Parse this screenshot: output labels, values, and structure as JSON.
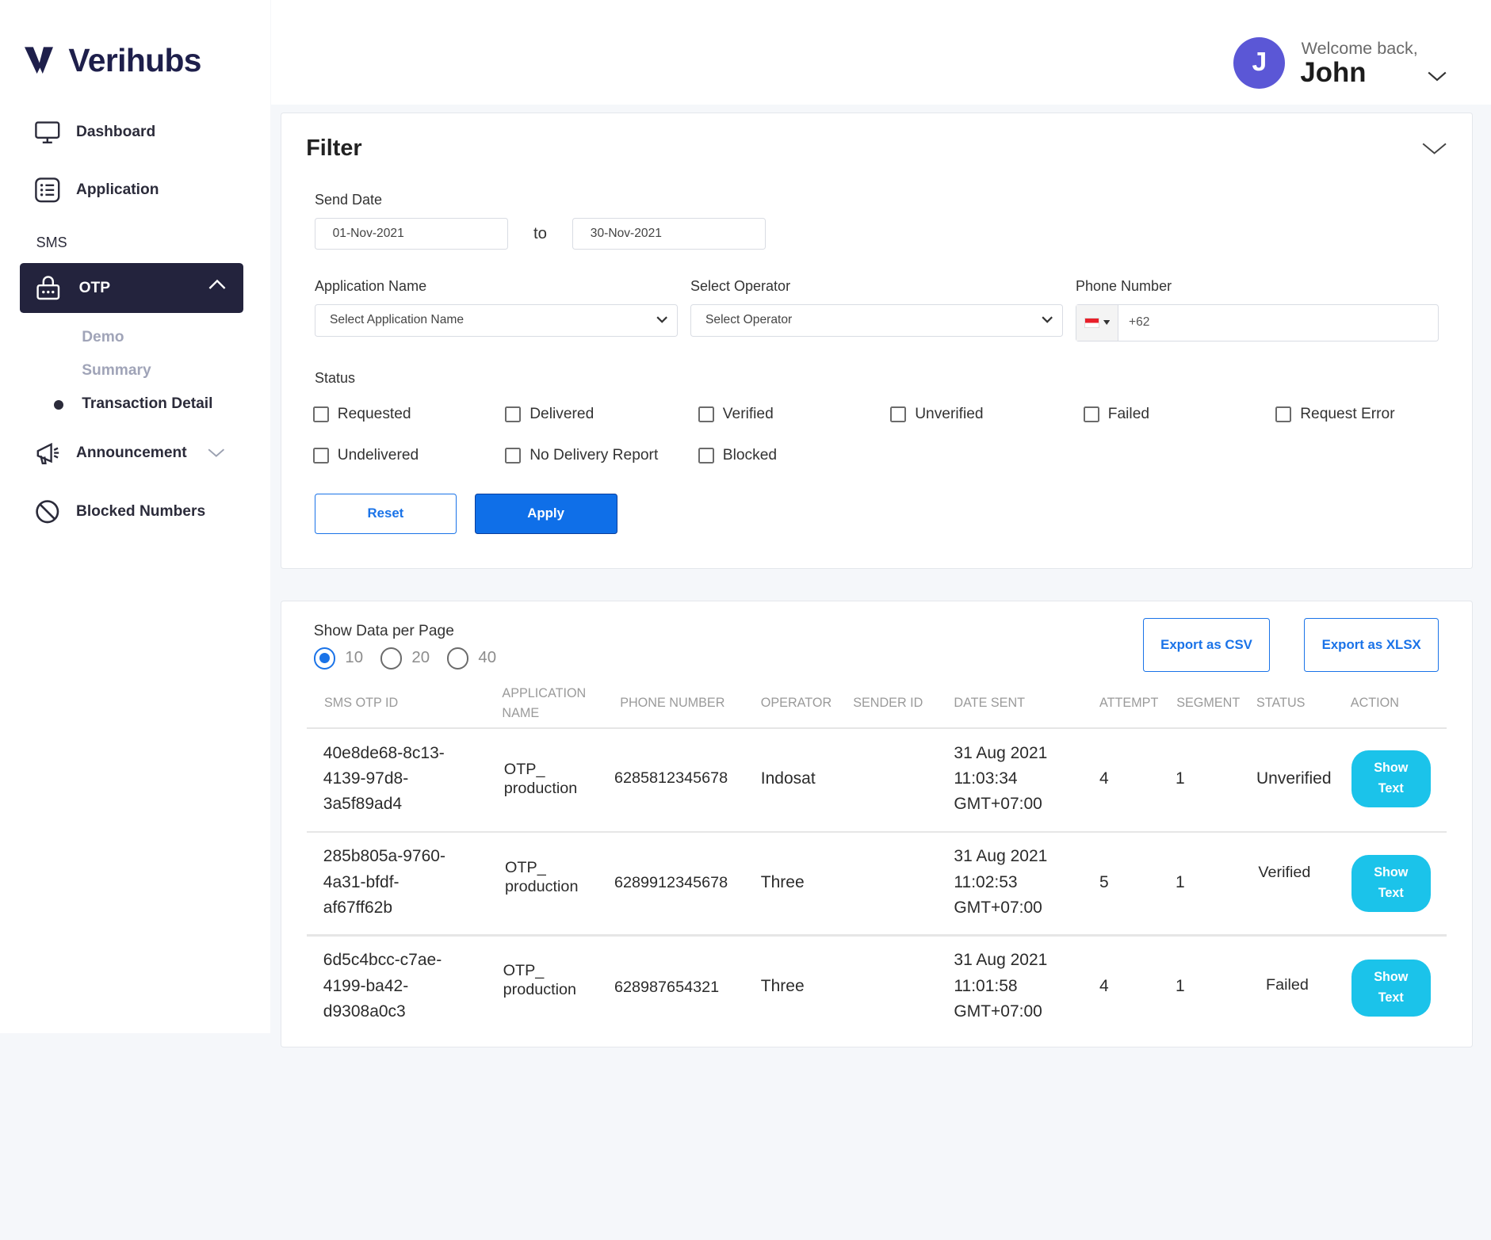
{
  "brand": {
    "name": "Verihubs"
  },
  "sidebar": {
    "dashboard": "Dashboard",
    "application": "Application",
    "section": "SMS",
    "otp": "OTP",
    "otp_sub": [
      "Demo",
      "Summary",
      "Transaction Detail"
    ],
    "announcement": "Announcement",
    "blocked": "Blocked Numbers"
  },
  "user": {
    "welcome": "Welcome back,",
    "name": "John",
    "initial": "J"
  },
  "filter": {
    "title": "Filter",
    "send_date_label": "Send Date",
    "date_from": "01-Nov-2021",
    "to_label": "to",
    "date_to": "30-Nov-2021",
    "app_name_label": "Application Name",
    "app_name_value": "Select Application Name",
    "operator_label": "Select Operator",
    "operator_value": "Select Operator",
    "phone_label": "Phone Number",
    "phone_value": "+62",
    "status_label": "Status",
    "statuses": [
      "Requested",
      "Delivered",
      "Verified",
      "Unverified",
      "Failed",
      "Request Error",
      "Undelivered",
      "No Delivery Report",
      "Blocked"
    ],
    "reset": "Reset",
    "apply": "Apply"
  },
  "table": {
    "per_page_label": "Show Data per Page",
    "per_page_options": [
      "10",
      "20",
      "40"
    ],
    "per_page_selected": "10",
    "export_csv": "Export as CSV",
    "export_xlsx": "Export as XLSX",
    "columns": [
      "SMS OTP ID",
      "APPLICATION",
      "NAME",
      "PHONE NUMBER",
      "OPERATOR",
      "SENDER ID",
      "DATE SENT",
      "ATTEMPT",
      "SEGMENT",
      "STATUS",
      "ACTION"
    ],
    "rows": [
      {
        "id": [
          "40e8de68-8c13-",
          "4139-97d8-",
          "3a5f89ad4"
        ],
        "app": [
          "OTP_",
          "production"
        ],
        "phone": "6285812345678",
        "operator": "Indosat",
        "sender": "",
        "date": [
          "31 Aug 2021",
          "11:03:34",
          "GMT+07:00"
        ],
        "attempt": "4",
        "segment": "1",
        "status": "Unverified",
        "action": [
          "Show",
          "Text"
        ]
      },
      {
        "id": [
          "285b805a-9760-",
          "4a31-bfdf-",
          "af67ff62b"
        ],
        "app": [
          "OTP_",
          "production"
        ],
        "phone": "6289912345678",
        "operator": "Three",
        "sender": "",
        "date": [
          "31 Aug 2021",
          "11:02:53",
          "GMT+07:00"
        ],
        "attempt": "5",
        "segment": "1",
        "status": "Verified",
        "action": [
          "Show",
          "Text"
        ]
      },
      {
        "id": [
          "6d5c4bcc-c7ae-",
          "4199-ba42-",
          "d9308a0c3"
        ],
        "app": [
          "OTP_",
          "production"
        ],
        "phone": "628987654321",
        "operator": "Three",
        "sender": "",
        "date": [
          "31 Aug 2021",
          "11:01:58",
          "GMT+07:00"
        ],
        "attempt": "4",
        "segment": "1",
        "status": "Failed",
        "action": [
          "Show",
          "Text"
        ]
      }
    ]
  },
  "colors": {
    "primary": "#1a73e8",
    "sidebar_active": "#23233d",
    "show_button": "#1bc3ea",
    "avatar": "#5b57d6"
  }
}
